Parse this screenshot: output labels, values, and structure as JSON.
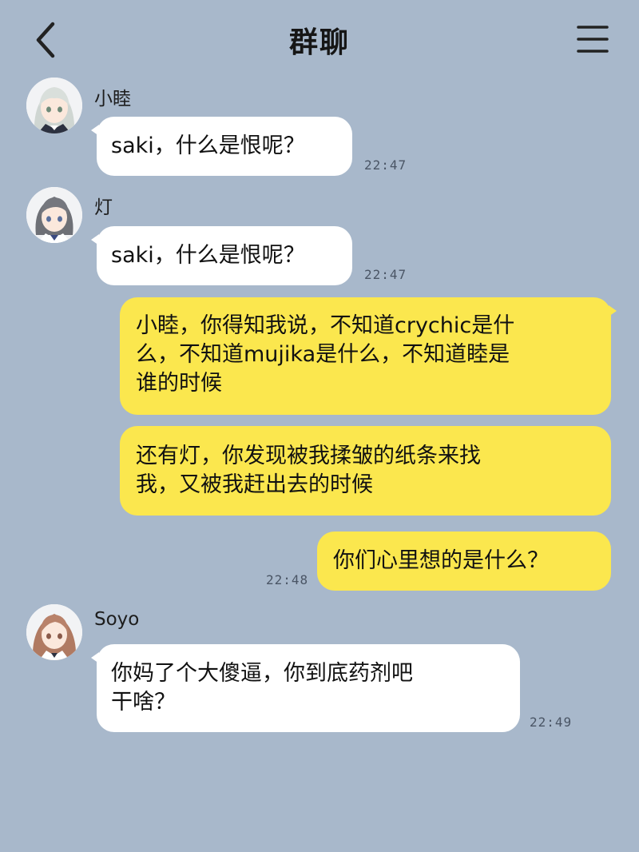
{
  "header": {
    "title": "群聊",
    "back_icon": "chevron-left-icon",
    "menu_icon": "hamburger-menu-icon"
  },
  "colors": {
    "background": "#a8b8cb",
    "incoming_bubble": "#ffffff",
    "outgoing_bubble": "#fbe74e"
  },
  "messages": [
    {
      "sender": "小睦",
      "avatar_icon": "silver-hair-girl-avatar",
      "text": "saki，什么是恨呢？",
      "time": "22:47"
    },
    {
      "sender": "灯",
      "avatar_icon": "gray-hair-girl-avatar",
      "text": "saki，什么是恨呢？",
      "time": "22:47"
    },
    {
      "sender": "",
      "text_lines": [
        "小睦，你得知我说，不知道crychic是什",
        "么，不知道mujika是什么，不知道睦是",
        "谁的时候"
      ]
    },
    {
      "sender": "",
      "text_lines": [
        "还有灯，你发现被我揉皱的纸条来找",
        "我，又被我赶出去的时候"
      ]
    },
    {
      "sender": "",
      "text": "你们心里想的是什么？",
      "time": "22:48"
    },
    {
      "sender": "Soyo",
      "avatar_icon": "brown-hair-girl-avatar",
      "text_lines": [
        "你妈了个大傻逼，你到底药剂吧",
        "干啥？"
      ],
      "time": "22:49"
    }
  ]
}
